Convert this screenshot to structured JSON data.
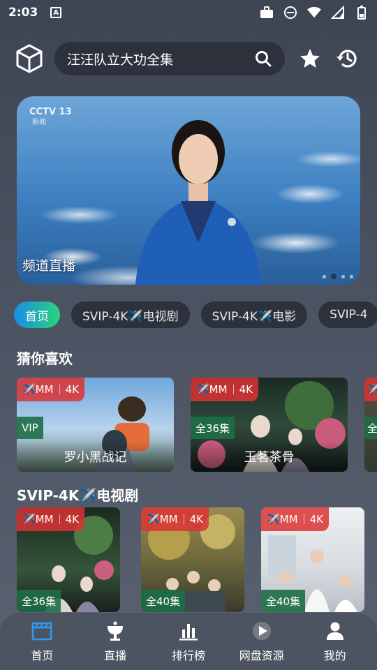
{
  "status": {
    "time": "2:03",
    "a_badge": "A"
  },
  "header": {
    "search_query": "汪汪队立大功全集"
  },
  "banner": {
    "cctv_logo": "CCTV 13",
    "cctv_sub": "新闻",
    "caption": "频道直播",
    "dots_count": 4,
    "active_dot": 1
  },
  "tabs": [
    {
      "label": "首页",
      "active": true
    },
    {
      "label": "SVIP-4K✈️电视剧",
      "active": false
    },
    {
      "label": "SVIP-4K✈️电影",
      "active": false
    },
    {
      "label": "SVIP-4",
      "active": false
    }
  ],
  "sections": {
    "guess": {
      "title": "猜你喜欢",
      "cards": [
        {
          "tag_left": "✈️MM",
          "tag_right": "4K",
          "badge": "VIP",
          "caption": "罗小黑战记"
        },
        {
          "tag_left": "✈️MM",
          "tag_right": "4K",
          "badge": "全36集",
          "caption": "玉茗茶骨"
        },
        {
          "tag_left": "✈️",
          "tag_right": "",
          "badge": "全",
          "caption": ""
        }
      ]
    },
    "tv": {
      "title": "SVIP-4K✈️电视剧",
      "cards": [
        {
          "tag_left": "✈️MM",
          "tag_right": "4K",
          "badge": "全36集"
        },
        {
          "tag_left": "✈️MM",
          "tag_right": "4K",
          "badge": "全40集"
        },
        {
          "tag_left": "✈️MM",
          "tag_right": "4K",
          "badge": "全40集"
        }
      ]
    }
  },
  "bottom_nav": [
    {
      "label": "首页",
      "icon": "clapperboard-icon",
      "active": true
    },
    {
      "label": "直播",
      "icon": "satellite-dish-icon",
      "active": false
    },
    {
      "label": "排行榜",
      "icon": "bar-chart-icon",
      "active": false
    },
    {
      "label": "网盘资源",
      "icon": "play-disc-icon",
      "active": false
    },
    {
      "label": "我的",
      "icon": "person-icon",
      "active": false
    }
  ],
  "colors": {
    "accent_blue": "#1a8ce8",
    "accent_green": "#2bd47a",
    "tag_red": "#dc3232",
    "badge_green": "#1e6e46"
  }
}
